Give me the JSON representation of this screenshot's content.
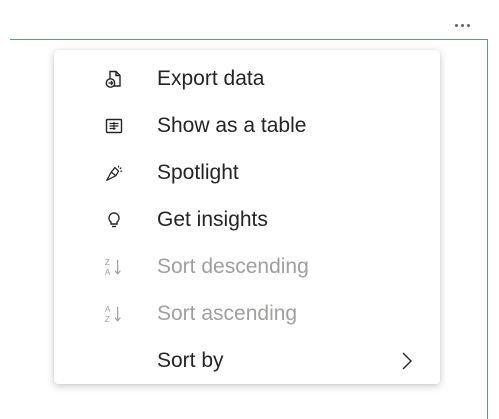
{
  "menu": {
    "items": [
      {
        "label": "Export data",
        "icon": "export-data-icon",
        "enabled": true
      },
      {
        "label": "Show as a table",
        "icon": "table-icon",
        "enabled": true
      },
      {
        "label": "Spotlight",
        "icon": "spotlight-icon",
        "enabled": true
      },
      {
        "label": "Get insights",
        "icon": "lightbulb-icon",
        "enabled": true
      },
      {
        "label": "Sort descending",
        "icon": "sort-descending-icon",
        "enabled": false
      },
      {
        "label": "Sort ascending",
        "icon": "sort-ascending-icon",
        "enabled": false
      },
      {
        "label": "Sort by",
        "icon": "chevron-right-icon",
        "enabled": true,
        "has_submenu": true
      }
    ]
  },
  "colors": {
    "frame_border": "#5a8fd6",
    "text": "#252423",
    "disabled_text": "#a19f9d",
    "icon": "#252423"
  }
}
